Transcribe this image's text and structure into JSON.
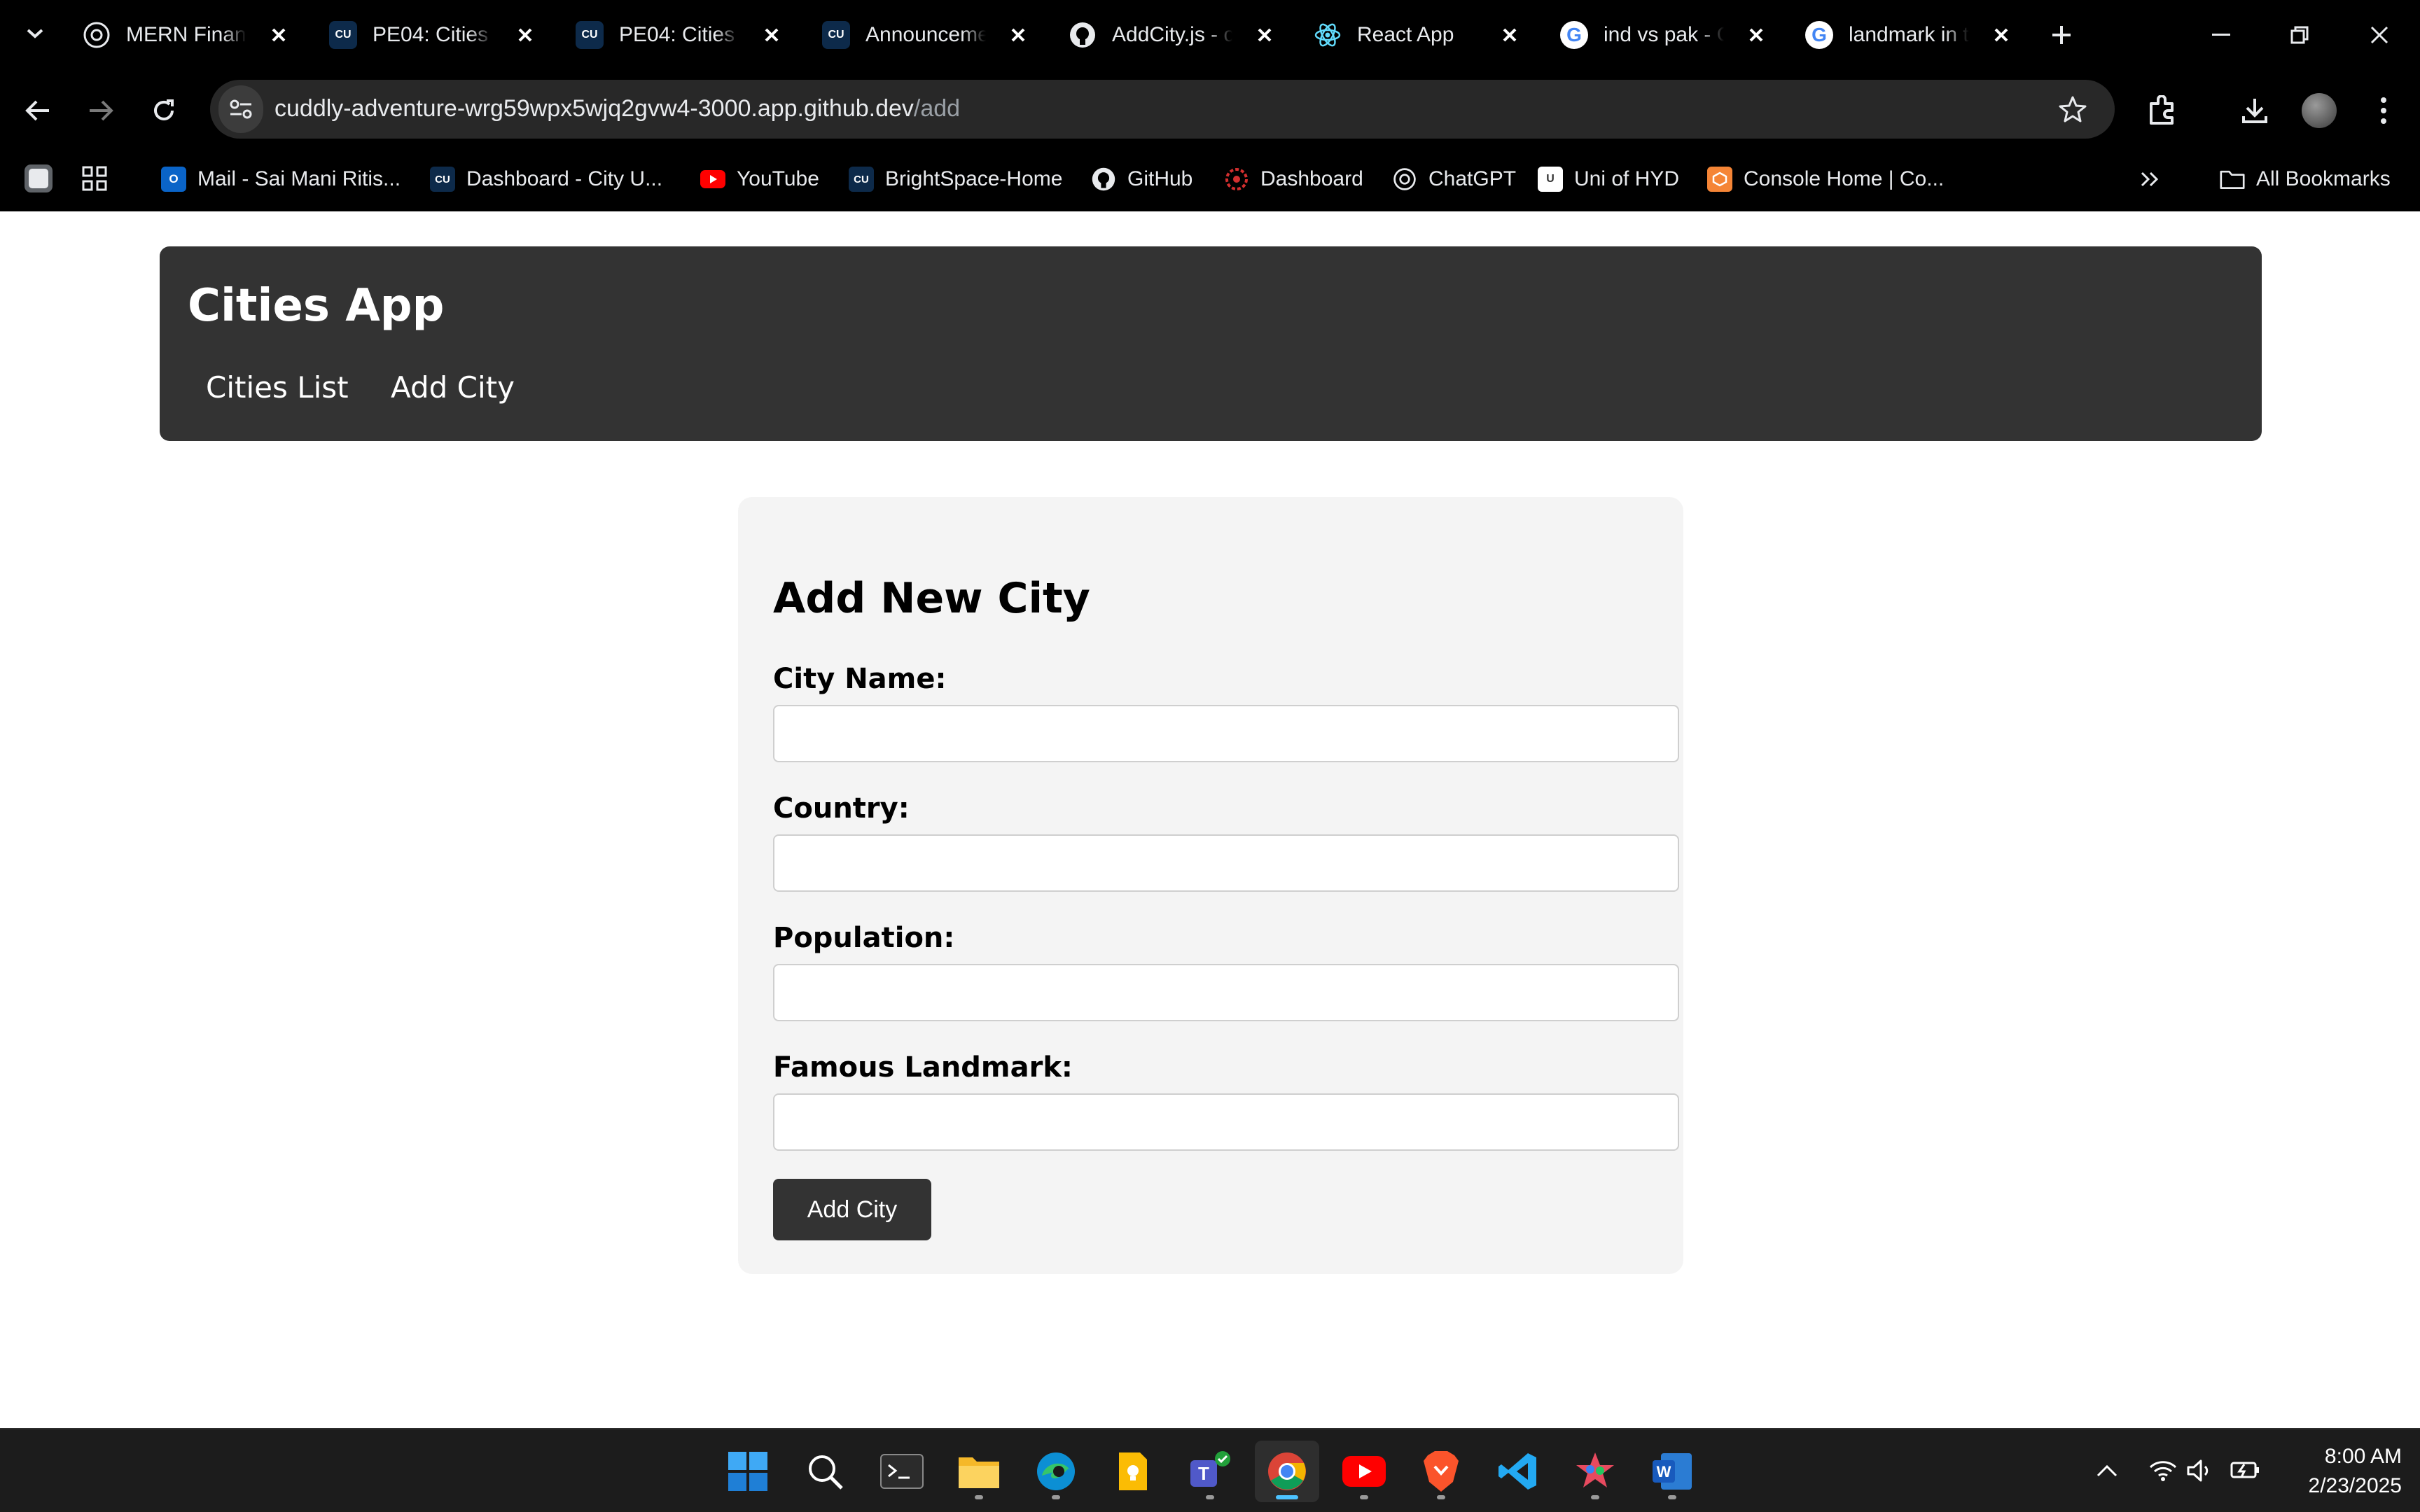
{
  "browser": {
    "tabs": [
      {
        "title": "MERN Financ",
        "icon": "openai-icon"
      },
      {
        "title": "PE04: Cities -",
        "icon": "cu-icon"
      },
      {
        "title": "PE04: Cities -",
        "icon": "cu-icon"
      },
      {
        "title": "Announceme",
        "icon": "cu-icon"
      },
      {
        "title": "AddCity.js - c",
        "icon": "github-icon"
      },
      {
        "title": "React App",
        "icon": "react-icon"
      },
      {
        "title": "ind vs pak - G",
        "icon": "google-icon"
      },
      {
        "title": "landmark in t",
        "icon": "google-icon"
      }
    ],
    "url_host": "cuddly-adventure-wrg59wpx5wjq2gvw4-3000.app.github.dev",
    "url_path": "/add",
    "bookmarks": [
      {
        "label": "Mail - Sai Mani Ritis...",
        "icon": "outlook-icon"
      },
      {
        "label": "Dashboard - City U...",
        "icon": "cu-icon"
      },
      {
        "label": "YouTube",
        "icon": "youtube-icon"
      },
      {
        "label": "BrightSpace-Home",
        "icon": "cu-icon"
      },
      {
        "label": "GitHub",
        "icon": "github-icon"
      },
      {
        "label": "Dashboard",
        "icon": "dashboard-icon"
      },
      {
        "label": "ChatGPT",
        "icon": "openai-icon"
      },
      {
        "label": "Uni of HYD",
        "icon": "uohyd-icon"
      },
      {
        "label": "Console Home | Co...",
        "icon": "aws-icon"
      }
    ],
    "all_bookmarks_label": "All Bookmarks"
  },
  "app": {
    "title": "Cities App",
    "nav": {
      "cities_list": "Cities List",
      "add_city": "Add City"
    }
  },
  "form": {
    "heading": "Add New City",
    "city_name_label": "City Name:",
    "country_label": "Country:",
    "population_label": "Population:",
    "landmark_label": "Famous Landmark:",
    "city_name_value": "",
    "country_value": "",
    "population_value": "",
    "landmark_value": "",
    "submit_label": "Add City"
  },
  "taskbar": {
    "apps": [
      "windows-start-icon",
      "search-icon",
      "terminal-icon",
      "file-explorer-icon",
      "edge-icon",
      "keep-icon",
      "teams-icon",
      "chrome-icon",
      "youtube-icon",
      "brave-icon",
      "vscode-icon",
      "paint-icon",
      "word-icon"
    ],
    "time": "8:00 AM",
    "date": "2/23/2025"
  },
  "colors": {
    "header_bg": "#333333",
    "card_bg": "#f4f4f4",
    "button_bg": "#333333",
    "chrome_bg": "#000000"
  }
}
